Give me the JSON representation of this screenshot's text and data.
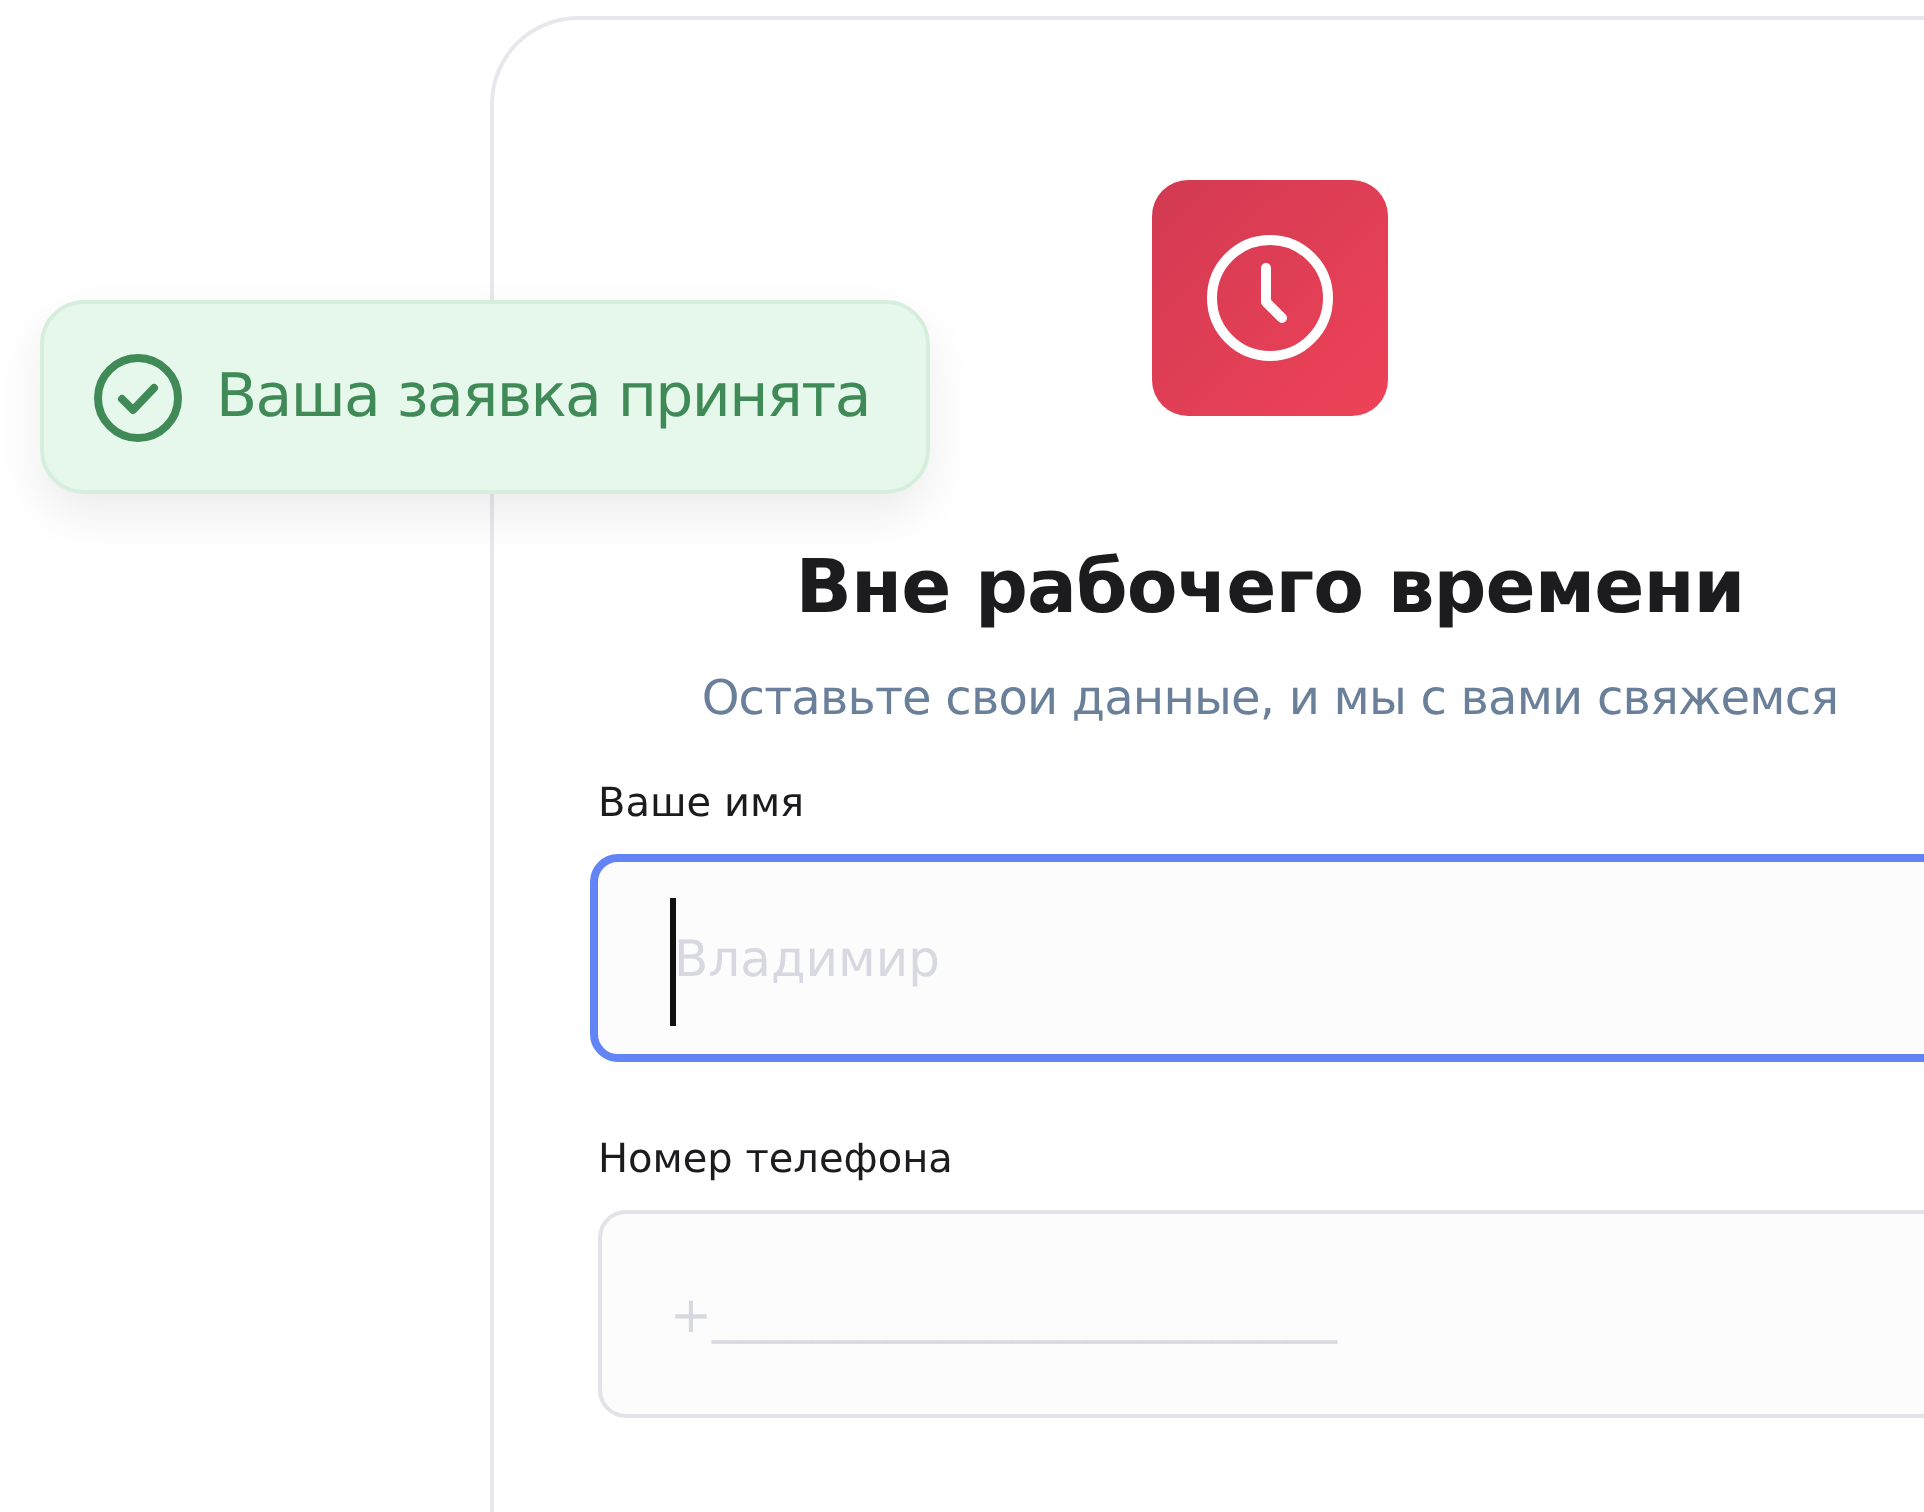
{
  "toast": {
    "text": "Ваша заявка принята"
  },
  "card": {
    "title": "Вне рабочего времени",
    "subtitle": "Оставьте свои данные, и мы с вами свяжемся"
  },
  "fields": [
    {
      "label": "Ваше имя",
      "placeholder": "Владимир",
      "focused": true
    },
    {
      "label": "Номер телефона",
      "placeholder": "+_________________________",
      "focused": false
    }
  ]
}
